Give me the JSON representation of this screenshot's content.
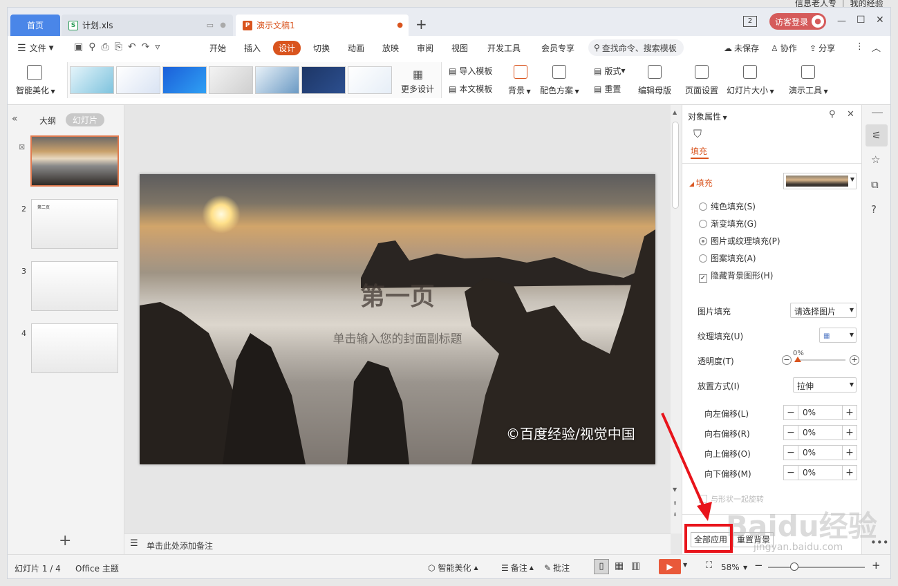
{
  "titlebar": {
    "tabs": [
      {
        "label": "首页"
      },
      {
        "label": "计划.xls",
        "icon_letter": "S"
      },
      {
        "label": "演示文稿1",
        "icon_letter": "P"
      }
    ],
    "new_tab": "+",
    "page_badge": "2",
    "login_label": "访客登录",
    "win_min": "—",
    "win_max": "☐",
    "win_close": "✕",
    "top_partial_text": "信息老人专 ｜ 我的经验"
  },
  "menubar": {
    "file_label": "文件",
    "items": [
      "开始",
      "插入",
      "设计",
      "切换",
      "动画",
      "放映",
      "审阅",
      "视图",
      "开发工具",
      "会员专享"
    ],
    "search_placeholder": "查找命令、搜索模板",
    "unsaved": "未保存",
    "collab": "协作",
    "share": "分享"
  },
  "ribbon": {
    "smart_beautify": "智能美化",
    "more_design": "更多设计",
    "import_template": "导入模板",
    "this_template": "本文模板",
    "background": "背景",
    "color_scheme": "配色方案",
    "layout": "版式",
    "reset": "重置",
    "edit_master": "编辑母版",
    "page_setup": "页面设置",
    "slide_size": "幻灯片大小",
    "present_tools": "演示工具"
  },
  "leftpanel": {
    "outline": "大纲",
    "slides": "幻灯片",
    "slide_numbers": [
      "1",
      "2",
      "3",
      "4"
    ],
    "slide2_text": "第二页",
    "add": "+"
  },
  "slide": {
    "title": "第一页",
    "subtitle": "单击输入您的封面副标题",
    "watermark": "©百度经验/视觉中国"
  },
  "notes": {
    "placeholder": "单击此处添加备注"
  },
  "rightpanel": {
    "header": "对象属性",
    "tab_fill": "填充",
    "section_fill": "填充",
    "options": [
      "纯色填充(S)",
      "渐变填充(G)",
      "图片或纹理填充(P)",
      "图案填充(A)"
    ],
    "selected_option": 2,
    "hide_bg": "隐藏背景图形(H)",
    "picture_fill_label": "图片填充",
    "picture_fill_value": "请选择图片",
    "texture_fill_label": "纹理填充(U)",
    "transparency_label": "透明度(T)",
    "transparency_value": "0%",
    "placement_label": "放置方式(I)",
    "placement_value": "拉伸",
    "offsets": [
      {
        "label": "向左偏移(L)",
        "value": "0%"
      },
      {
        "label": "向右偏移(R)",
        "value": "0%"
      },
      {
        "label": "向上偏移(O)",
        "value": "0%"
      },
      {
        "label": "向下偏移(M)",
        "value": "0%"
      }
    ],
    "rotate_with_shape": "与形状一起旋转",
    "apply_all": "全部应用",
    "reset_bg": "重置背景"
  },
  "statusbar": {
    "slide_counter": "幻灯片 1 / 4",
    "theme": "Office 主题",
    "smart_beautify": "智能美化",
    "notes": "备注",
    "comments": "批注",
    "zoom": "58%"
  },
  "watermark": {
    "text": "Baidu经验",
    "url": "jingyan.baidu.com"
  },
  "colors": {
    "accent": "#d9541e",
    "home_tab": "#4a86e8",
    "annotation_red": "#e8141b"
  }
}
